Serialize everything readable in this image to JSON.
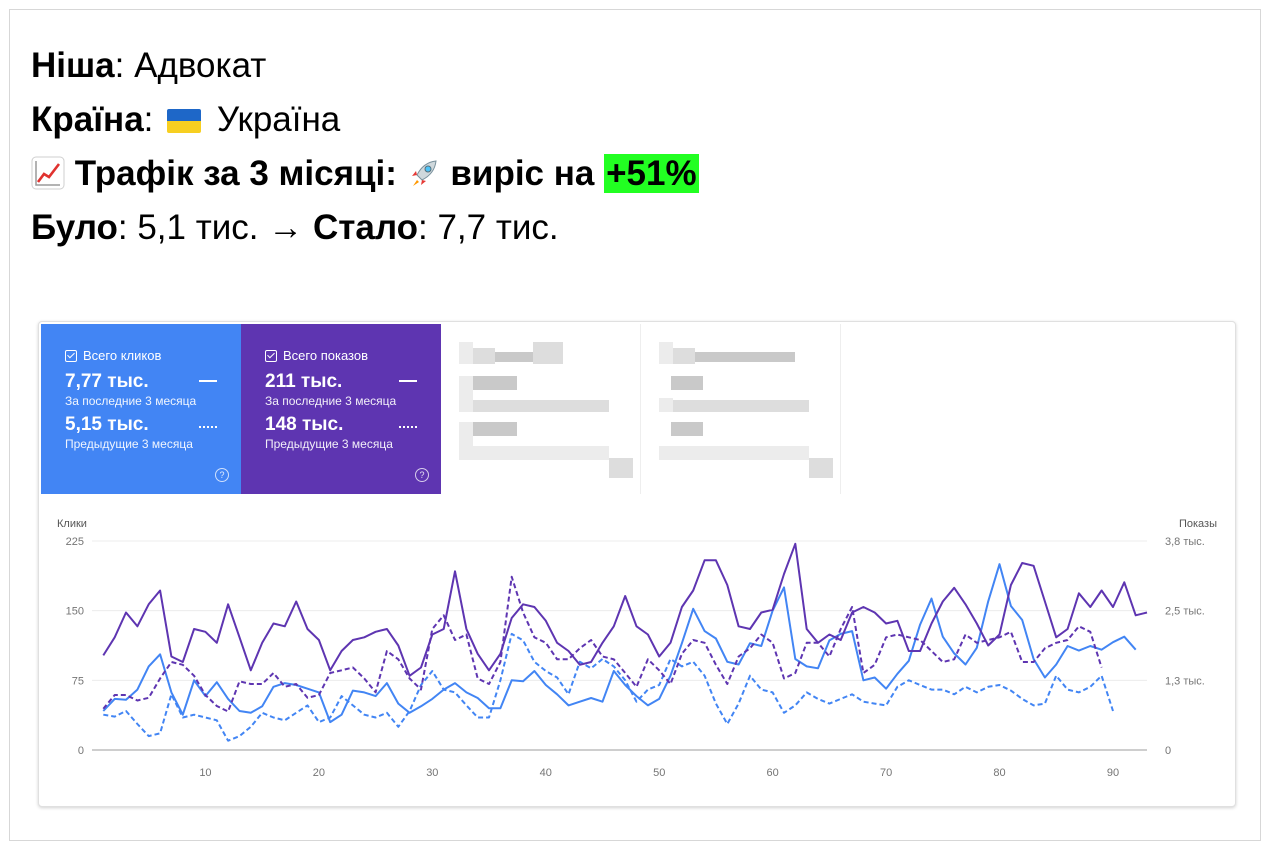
{
  "header": {
    "niche_label": "Ніша",
    "niche_value": "Адвокат",
    "country_label": "Країна",
    "country_value": "Україна",
    "traffic_label": "Трафік за 3 місяці:",
    "growth_text": "виріс на",
    "growth_value": "+51%",
    "was_label": "Було",
    "was_value": "5,1 тис.",
    "arrow": "→",
    "now_label": "Стало",
    "now_value": "7,7 тис."
  },
  "cards": {
    "clicks": {
      "title": "Всего кликов",
      "current": "7,77 тыс.",
      "current_sub": "За последние 3 месяца",
      "previous": "5,15 тыс.",
      "previous_sub": "Предыдущие 3 месяца",
      "help": "?"
    },
    "impressions": {
      "title": "Всего показов",
      "current": "211 тыс.",
      "current_sub": "За последние 3 месяца",
      "previous": "148 тыс.",
      "previous_sub": "Предыдущие 3 месяца",
      "help": "?"
    }
  },
  "colors": {
    "clicks": "#4285f4",
    "impressions": "#5e35b1",
    "growth_highlight": "#22ff22"
  },
  "chart_data": {
    "type": "line",
    "left_axis_label": "Клики",
    "right_axis_label": "Показы",
    "left_ticks": [
      "0",
      "75",
      "150",
      "225"
    ],
    "right_ticks": [
      "0",
      "1,3 тыс.",
      "2,5 тыс.",
      "3,8 тыс."
    ],
    "x_ticks": [
      "10",
      "20",
      "30",
      "40",
      "50",
      "60",
      "70",
      "80",
      "90"
    ],
    "ylim_left": [
      0,
      225
    ],
    "ylim_right": [
      0,
      3800
    ],
    "xlim": [
      0,
      93
    ],
    "series": [
      {
        "id": "clicks_current",
        "style": "solid",
        "color": "#4285f4",
        "x_start": 1,
        "values": [
          42,
          55,
          54,
          65,
          90,
          103,
          62,
          38,
          75,
          58,
          73,
          55,
          42,
          40,
          47,
          68,
          72,
          70,
          66,
          62,
          30,
          38,
          64,
          62,
          58,
          72,
          50,
          40,
          47,
          55,
          65,
          72,
          62,
          56,
          45,
          45,
          75,
          74,
          85,
          70,
          60,
          48,
          52,
          56,
          52,
          85,
          70,
          58,
          48,
          55,
          80,
          115,
          152,
          128,
          120,
          95,
          92,
          115,
          112,
          150,
          175,
          98,
          90,
          88,
          118,
          125,
          128,
          75,
          78,
          66,
          82,
          96,
          135,
          163,
          122,
          104,
          92,
          110,
          160,
          200,
          155,
          140,
          98,
          78,
          92,
          112,
          107,
          112,
          108,
          116,
          122,
          108
        ]
      },
      {
        "id": "clicks_previous",
        "style": "dashed",
        "color": "#4285f4",
        "x_start": 1,
        "values": [
          38,
          36,
          42,
          28,
          15,
          18,
          60,
          35,
          38,
          35,
          32,
          10,
          15,
          25,
          40,
          35,
          32,
          40,
          48,
          30,
          35,
          58,
          48,
          38,
          35,
          40,
          25,
          42,
          70,
          85,
          65,
          62,
          48,
          35,
          35,
          75,
          125,
          118,
          95,
          85,
          78,
          60,
          95,
          88,
          98,
          90,
          75,
          52,
          65,
          70,
          98,
          90,
          95,
          80,
          50,
          28,
          50,
          80,
          65,
          62,
          40,
          48,
          62,
          55,
          50,
          55,
          60,
          52,
          50,
          48,
          68,
          75,
          70,
          65,
          65,
          60,
          68,
          62,
          68,
          70,
          64,
          55,
          48,
          50,
          80,
          65,
          62,
          68,
          80,
          42
        ]
      },
      {
        "id": "impressions_current",
        "style": "solid",
        "color": "#5e35b1",
        "x_start": 1,
        "values": [
          1720,
          2050,
          2500,
          2250,
          2650,
          2900,
          1700,
          1600,
          2200,
          2150,
          1950,
          2650,
          2050,
          1450,
          1950,
          2300,
          2250,
          2700,
          2200,
          2000,
          1450,
          1800,
          2000,
          2050,
          2150,
          2200,
          1900,
          1350,
          1500,
          2100,
          2200,
          3250,
          2200,
          1750,
          1450,
          1750,
          2400,
          2650,
          2600,
          2350,
          1950,
          1800,
          1550,
          1600,
          1950,
          2250,
          2800,
          2250,
          2100,
          1700,
          1950,
          2600,
          2900,
          3450,
          3450,
          3000,
          2250,
          2200,
          2500,
          2550,
          3200,
          3750,
          2200,
          1950,
          2100,
          2000,
          2500,
          2600,
          2500,
          2300,
          2350,
          1800,
          1800,
          2300,
          2700,
          2950,
          2650,
          2300,
          1900,
          2100,
          3000,
          3400,
          3350,
          2700,
          2050,
          2200,
          2850,
          2600,
          2900,
          2600,
          3050,
          2450,
          2500
        ]
      },
      {
        "id": "impressions_previous",
        "style": "dashed",
        "color": "#5e35b1",
        "x_start": 1,
        "values": [
          750,
          1000,
          1000,
          900,
          950,
          1300,
          1600,
          1550,
          1350,
          1000,
          800,
          700,
          1250,
          1200,
          1200,
          1400,
          1150,
          1200,
          950,
          1000,
          1400,
          1450,
          1500,
          1300,
          1050,
          1800,
          1650,
          1300,
          1100,
          2200,
          2450,
          2000,
          2100,
          1300,
          1200,
          1600,
          3150,
          2500,
          2050,
          1950,
          1650,
          1650,
          1850,
          2000,
          1700,
          1650,
          1400,
          1150,
          1650,
          1450,
          1200,
          1750,
          2000,
          1950,
          1550,
          1200,
          1700,
          1850,
          2100,
          1950,
          1300,
          1400,
          1950,
          1950,
          1700,
          2200,
          2600,
          1400,
          1550,
          2050,
          2100,
          2050,
          2000,
          1800,
          1600,
          1650,
          2100,
          1950,
          2000,
          2050,
          2150,
          1600,
          1600,
          1850,
          1950,
          2000,
          2250,
          2150,
          1500
        ]
      }
    ]
  }
}
